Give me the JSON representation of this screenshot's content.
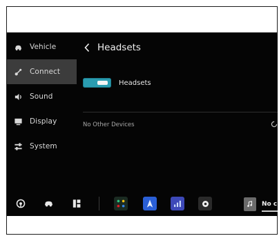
{
  "sidebar": {
    "items": [
      {
        "label": "Vehicle",
        "icon": "car-icon",
        "active": false
      },
      {
        "label": "Connect",
        "icon": "connect-icon",
        "active": true
      },
      {
        "label": "Sound",
        "icon": "speaker-icon",
        "active": false
      },
      {
        "label": "Display",
        "icon": "monitor-icon",
        "active": false
      },
      {
        "label": "System",
        "icon": "sliders-icon",
        "active": false
      }
    ]
  },
  "header": {
    "back_icon": "chevron-left-icon",
    "title": "Headsets"
  },
  "device": {
    "label": "Headsets",
    "toggle_on": true
  },
  "other_devices": {
    "label": "No Other Devices",
    "status_icon": "loading-spinner-icon"
  },
  "dock": {
    "icons": [
      "steering-icon",
      "car-icon",
      "apps-grid-icon"
    ],
    "apps": [
      "phone-app-icon",
      "navigation-app-icon",
      "signal-app-icon",
      "settings-app-icon"
    ],
    "media": {
      "art_icon": "music-note-icon",
      "label": "No c"
    }
  },
  "colors": {
    "background": "#050505",
    "active_item": "#3c3c3c",
    "toggle": "#2a9cb0",
    "nav_tile": "#2a5fd6",
    "signal_tile": "#3d49b8"
  }
}
